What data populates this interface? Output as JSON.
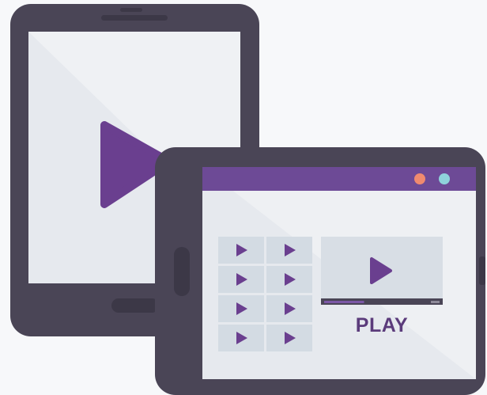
{
  "illustration": {
    "play_text": "PLAY",
    "icons": {
      "big_play": "play-icon",
      "thumb_play": "play-icon",
      "video_play": "play-icon"
    },
    "video": {
      "progress": 0.38
    },
    "colors": {
      "device_frame": "#4a4556",
      "screen_bg": "#e6e9ee",
      "screen_highlight": "#f2f4f7",
      "accent_purple": "#6a3f8f",
      "toolbar_purple": "#6d4a96",
      "dot_orange": "#f08a6f",
      "dot_teal": "#8fd2db",
      "thumb_bg": "#d3dbe3",
      "video_bg": "#d8dee5",
      "page_bg": "#f7f8fa"
    }
  }
}
